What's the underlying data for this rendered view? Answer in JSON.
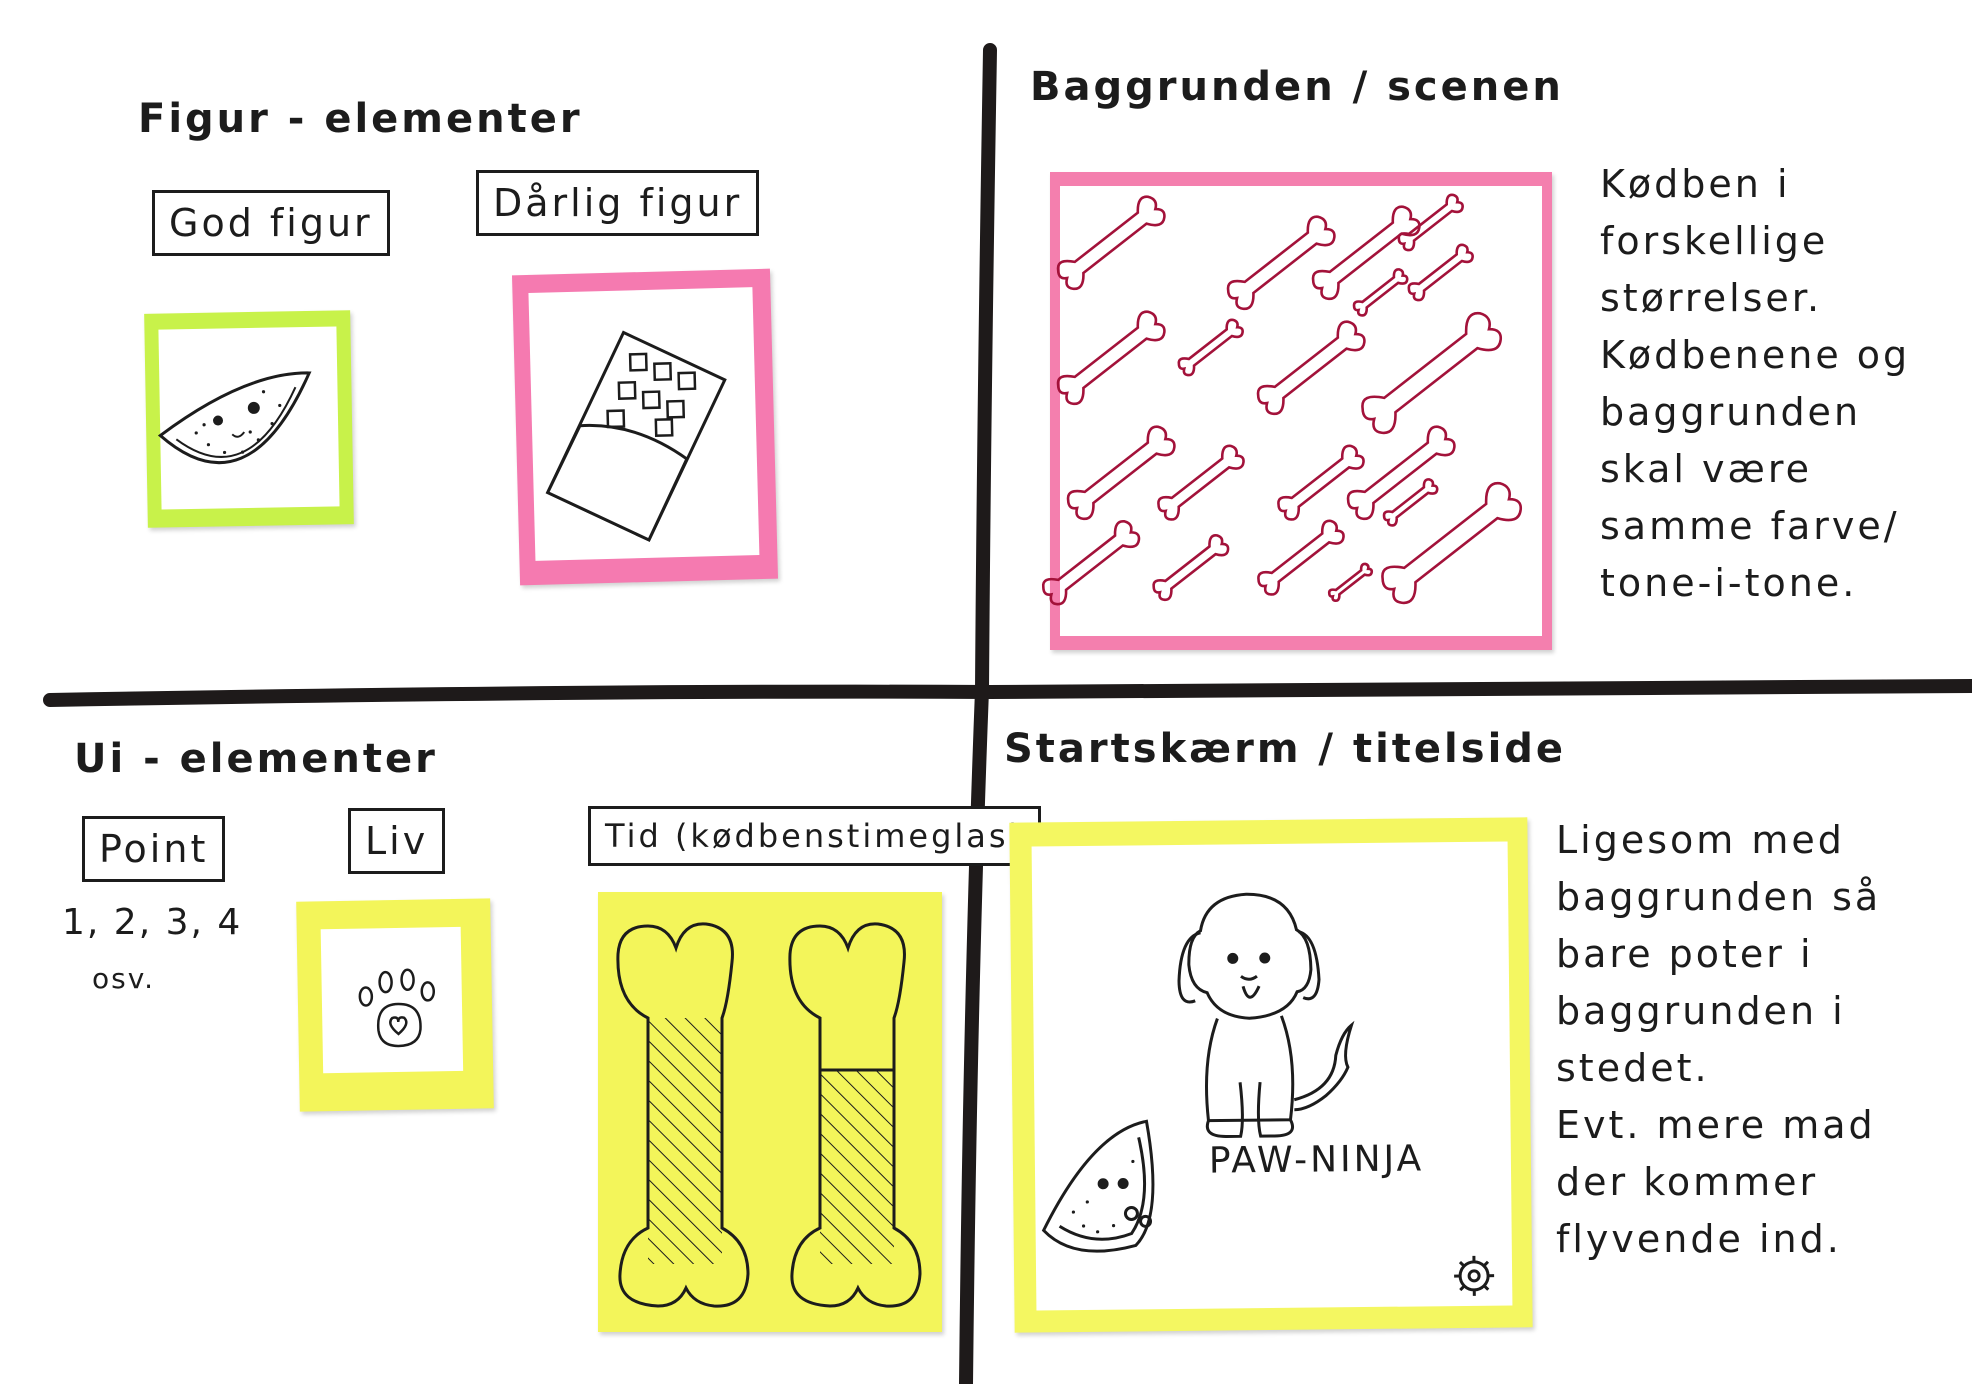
{
  "quadrants": {
    "figur": {
      "title": "Figur - elementer",
      "good_label": "God figur",
      "bad_label": "Dårlig figur",
      "good_note_color": "#c8f24a",
      "bad_note_color": "#f57ab0"
    },
    "baggrund": {
      "title": "Baggrunden / scenen",
      "note_color": "#f47fae",
      "bone_color": "#a3123a",
      "description": [
        "Kødben i",
        "forskellige",
        "størrelser.",
        "Kødbenene og",
        "baggrunden",
        "skal være",
        "samme farve/",
        "tone-i-tone."
      ]
    },
    "ui": {
      "title": "Ui - elementer",
      "point_label": "Point",
      "point_values": "1, 2, 3, 4",
      "point_etc": "osv.",
      "liv_label": "Liv",
      "tid_label": "Tid (kødbenstimeglas)",
      "note_color": "#f3f55a"
    },
    "start": {
      "title": "Startskærm / titelside",
      "logo_text": "PAW-NINJA",
      "note_color": "#f4f761",
      "description": [
        "Ligesom med",
        "baggrunden så",
        "bare poter i",
        "baggrunden i",
        "stedet.",
        "Evt. mere mad",
        "der kommer",
        "flyvende ind."
      ]
    }
  }
}
